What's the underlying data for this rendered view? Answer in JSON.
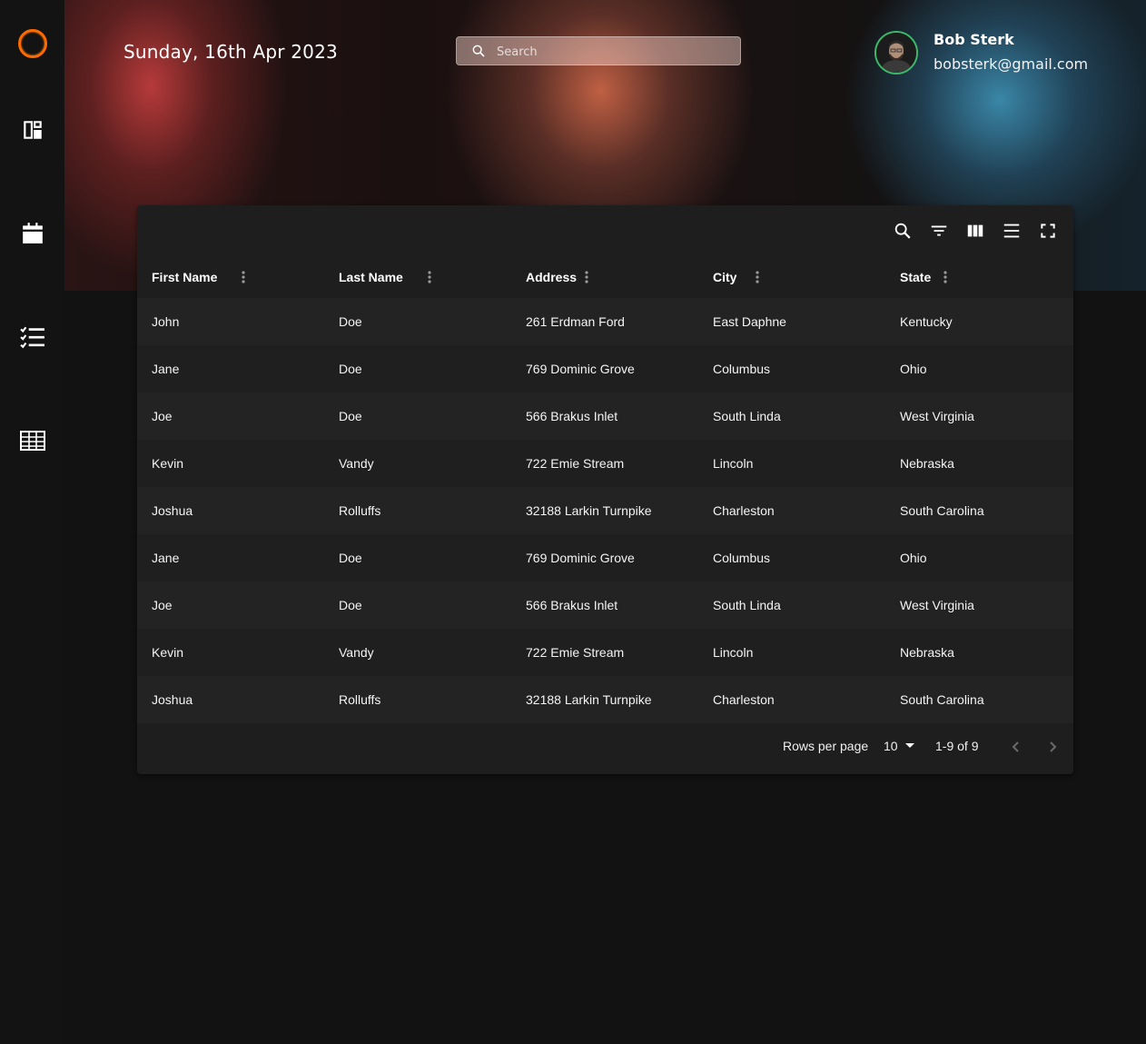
{
  "header": {
    "date": "Sunday, 16th Apr 2023",
    "search_placeholder": "Search",
    "user": {
      "name": "Bob Sterk",
      "email": "bobsterk@gmail.com"
    }
  },
  "sidebar": {
    "items": [
      {
        "icon": "logo-ring-icon"
      },
      {
        "icon": "dashboard-icon"
      },
      {
        "icon": "calendar-icon"
      },
      {
        "icon": "checklist-icon"
      },
      {
        "icon": "table-grid-icon"
      }
    ]
  },
  "colors": {
    "accent": "#ff6a00",
    "avatar_ring": "#3bb86a",
    "background": "#121212",
    "card": "#1e1e1e"
  },
  "table": {
    "toolbar": [
      "search-icon",
      "filter-icon",
      "columns-icon",
      "density-icon",
      "fullscreen-icon"
    ],
    "columns": [
      "First Name",
      "Last Name",
      "Address",
      "City",
      "State"
    ],
    "rows": [
      [
        "John",
        "Doe",
        "261 Erdman Ford",
        "East Daphne",
        "Kentucky"
      ],
      [
        "Jane",
        "Doe",
        "769 Dominic Grove",
        "Columbus",
        "Ohio"
      ],
      [
        "Joe",
        "Doe",
        "566 Brakus Inlet",
        "South Linda",
        "West Virginia"
      ],
      [
        "Kevin",
        "Vandy",
        "722 Emie Stream",
        "Lincoln",
        "Nebraska"
      ],
      [
        "Joshua",
        "Rolluffs",
        "32188 Larkin Turnpike",
        "Charleston",
        "South Carolina"
      ],
      [
        "Jane",
        "Doe",
        "769 Dominic Grove",
        "Columbus",
        "Ohio"
      ],
      [
        "Joe",
        "Doe",
        "566 Brakus Inlet",
        "South Linda",
        "West Virginia"
      ],
      [
        "Kevin",
        "Vandy",
        "722 Emie Stream",
        "Lincoln",
        "Nebraska"
      ],
      [
        "Joshua",
        "Rolluffs",
        "32188 Larkin Turnpike",
        "Charleston",
        "South Carolina"
      ]
    ],
    "footer": {
      "rows_per_page_label": "Rows per page",
      "rows_per_page_value": "10",
      "range": "1-9 of 9"
    }
  }
}
